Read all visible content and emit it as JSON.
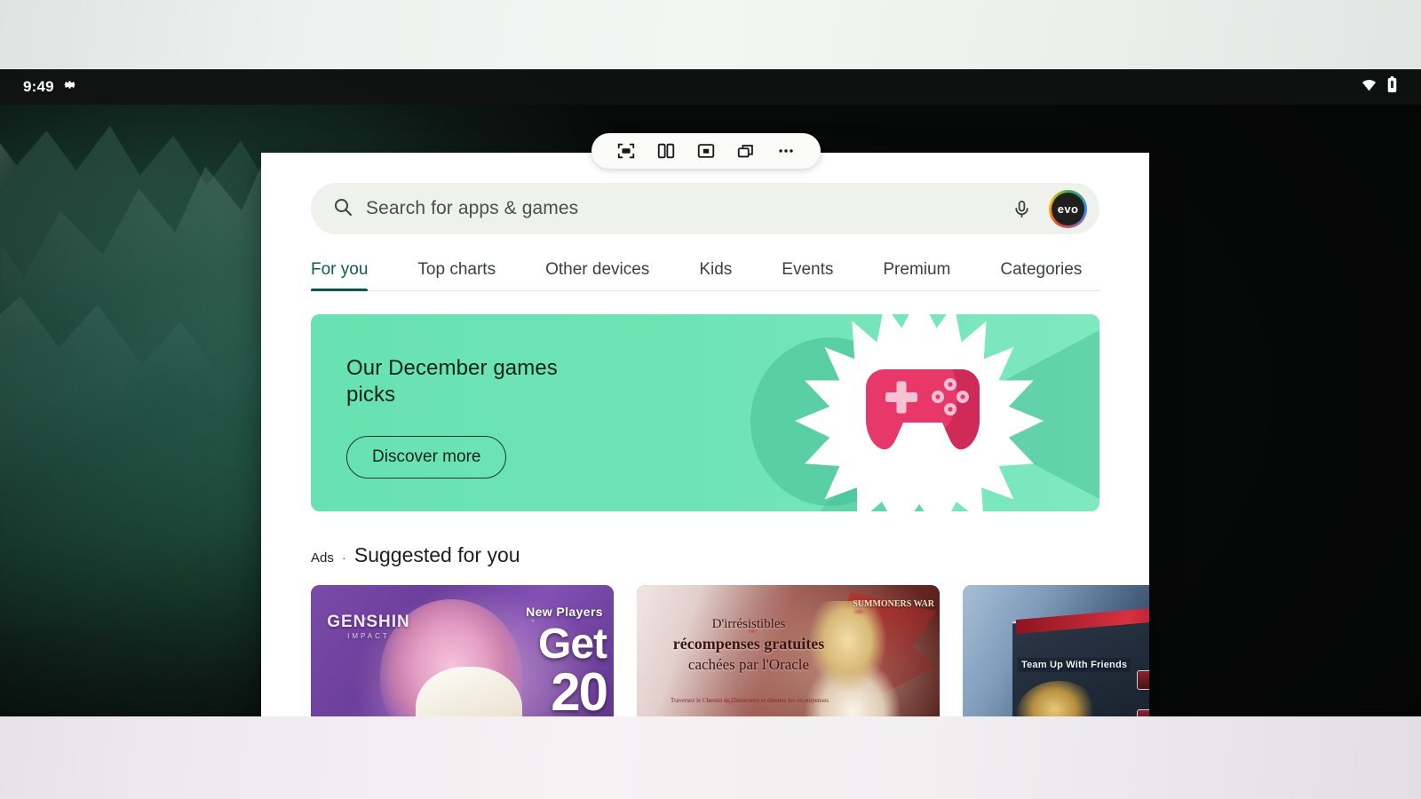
{
  "status_bar": {
    "clock": "9:49",
    "left_icons": [
      "settings-gear-icon"
    ],
    "right_icons": [
      "wifi-icon",
      "battery-icon"
    ]
  },
  "window_controls": {
    "buttons": [
      {
        "name": "fullscreen-icon",
        "label": "Fullscreen"
      },
      {
        "name": "split-screen-icon",
        "label": "Split screen"
      },
      {
        "name": "picture-in-picture-icon",
        "label": "Picture in picture"
      },
      {
        "name": "restore-window-icon",
        "label": "Restore window"
      },
      {
        "name": "more-options-icon",
        "label": "More options"
      }
    ]
  },
  "search": {
    "placeholder": "Search for apps & games",
    "value": "",
    "mic_icon": "microphone-icon",
    "avatar_initials": "evo"
  },
  "tabs": [
    {
      "label": "For you",
      "active": true
    },
    {
      "label": "Top charts",
      "active": false
    },
    {
      "label": "Other devices",
      "active": false
    },
    {
      "label": "Kids",
      "active": false
    },
    {
      "label": "Events",
      "active": false
    },
    {
      "label": "Premium",
      "active": false
    },
    {
      "label": "Categories",
      "active": false
    }
  ],
  "banner": {
    "title": "Our December games picks",
    "button_label": "Discover more",
    "background_color": "#6fe3b4",
    "accent_color": "#e8386a",
    "illustration": "game-controller-starburst"
  },
  "suggested": {
    "ads_label": "Ads",
    "separator": "·",
    "title": "Suggested for you",
    "cards": [
      {
        "name": "genshin-impact-ad",
        "logo_title": "GENSHIN",
        "logo_sub": "IMPACT",
        "headline": "New Players",
        "offer_line1": "Get",
        "offer_line2": "20"
      },
      {
        "name": "summoners-war-ad",
        "line1": "D'irrésistibles",
        "line2": "récompenses gratuites",
        "line3": "cachées par l'Oracle",
        "subtitle": "Traversez le Chemin de l'Innocence et obtenez les récompenses",
        "brand": "SUMMONERS WAR"
      },
      {
        "name": "team-game-ad",
        "headline": "Team Up With Friends"
      }
    ]
  }
}
